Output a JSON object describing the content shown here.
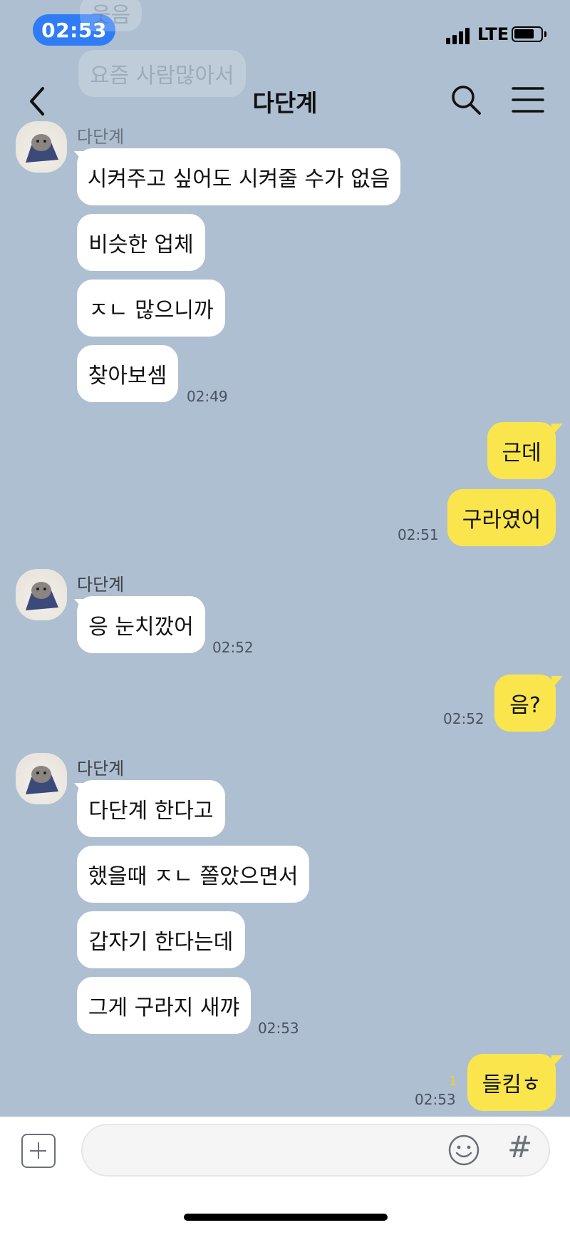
{
  "status_bar": {
    "time": "02:53",
    "network": "LTE"
  },
  "ghost_messages": [
    "웃음",
    "요즘 사람많아서"
  ],
  "header": {
    "title": "다단계"
  },
  "messages": [
    {
      "sender": "다단계",
      "texts": [
        "시켜주고 싶어도 시켜줄 수가 없음",
        "비슷한 업체",
        "ㅈㄴ 많으니까",
        "찾아보셈"
      ],
      "time": "02:49"
    },
    {
      "mine_texts": [
        "근데",
        "구라였어"
      ],
      "time": "02:51"
    },
    {
      "sender": "다단계",
      "texts": [
        "응 눈치깠어"
      ],
      "time": "02:52"
    },
    {
      "mine_texts": [
        "음?"
      ],
      "time": "02:52"
    },
    {
      "sender": "다단계",
      "texts": [
        "다단계 한다고",
        "했을때 ㅈㄴ 쫄았으면서",
        "갑자기 한다는데",
        "그게 구라지 새꺄"
      ],
      "time": "02:53"
    },
    {
      "mine_texts": [
        "들킴ㅎ"
      ],
      "time": "02:53",
      "unread": "1"
    }
  ],
  "colors": {
    "background": "#aebfd1",
    "my_bubble": "#fae64c",
    "their_bubble": "#ffffff",
    "time_pill": "#2f7cf6"
  },
  "icons": [
    "back-arrow-icon",
    "search-icon",
    "hamburger-menu-icon",
    "plus-icon",
    "emoji-icon",
    "hash-icon"
  ]
}
